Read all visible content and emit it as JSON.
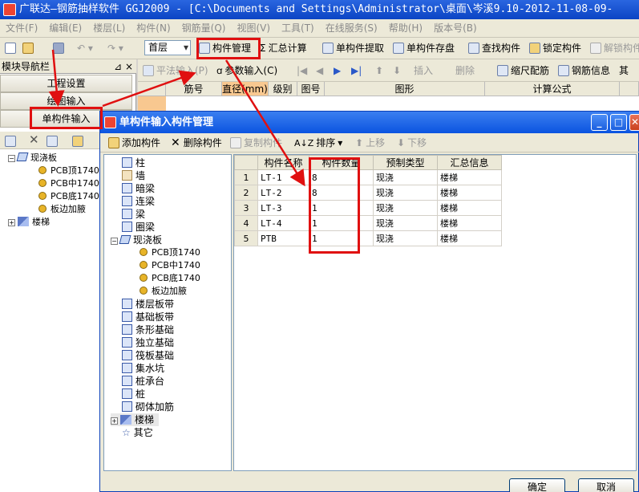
{
  "window": {
    "title": "广联达—钢筋抽样软件 GGJ2009 - [C:\\Documents and Settings\\Administrator\\桌面\\岑溪9.10-2012-11-08-09-"
  },
  "menu": [
    "文件(F)",
    "编辑(E)",
    "楼层(L)",
    "构件(N)",
    "钢筋量(Q)",
    "视图(V)",
    "工具(T)",
    "在线服务(S)",
    "帮助(H)",
    "版本号(B)"
  ],
  "toolbar": {
    "floor_select": "首层",
    "component_mgmt": "构件管理",
    "summary_calc": "汇总计算",
    "single_extract": "单构件提取",
    "single_save": "单构件存盘",
    "find_component": "查找构件",
    "lock_component": "锁定构件",
    "unlock_component": "解锁构件"
  },
  "toolbar2": {
    "flat_input": "平法输入(P)",
    "param_input": "参数输入(C)",
    "insert": "插入",
    "delete": "删除",
    "scale_rebar": "缩尺配筋",
    "rebar_info": "钢筋信息",
    "more": "其"
  },
  "left_panel": {
    "title": "模块导航栏",
    "close": "×",
    "pin": "⊿",
    "nav": [
      "工程设置",
      "绘图输入",
      "单构件输入"
    ],
    "tree": {
      "root": "现浇板",
      "children": [
        "PCB顶1740",
        "PCB中1740",
        "PCB底1740",
        "板边加腋"
      ],
      "stairs": "楼梯"
    }
  },
  "bg_grid": {
    "headers": [
      "筋号",
      "直径(mm)",
      "级别",
      "图号",
      "图形",
      "计算公式"
    ]
  },
  "dialog": {
    "title": "单构件输入构件管理",
    "toolbar": {
      "add": "添加构件",
      "delete": "删除构件",
      "copy": "复制构件",
      "sort": "排序",
      "up": "上移",
      "down": "下移"
    },
    "types": [
      "柱",
      "墙",
      "暗梁",
      "连梁",
      "梁",
      "圈梁",
      "现浇板",
      "楼层板带",
      "基础板带",
      "条形基础",
      "独立基础",
      "筏板基础",
      "集水坑",
      "桩承台",
      "桩",
      "砌体加筋",
      "楼梯",
      "其它"
    ],
    "slab_children": [
      "PCB顶1740",
      "PCB中1740",
      "PCB底1740",
      "板边加腋"
    ],
    "table": {
      "headers": [
        "构件名称",
        "构件数量",
        "预制类型",
        "汇总信息"
      ],
      "rows": [
        {
          "no": "1",
          "name": "LT-1",
          "qty": "8",
          "type": "现浇",
          "info": "楼梯"
        },
        {
          "no": "2",
          "name": "LT-2",
          "qty": "8",
          "type": "现浇",
          "info": "楼梯"
        },
        {
          "no": "3",
          "name": "LT-3",
          "qty": "1",
          "type": "现浇",
          "info": "楼梯"
        },
        {
          "no": "4",
          "name": "LT-4",
          "qty": "1",
          "type": "现浇",
          "info": "楼梯"
        },
        {
          "no": "5",
          "name": "PTB",
          "qty": "1",
          "type": "现浇",
          "info": "楼梯"
        }
      ]
    },
    "ok": "确定",
    "cancel": "取消"
  }
}
